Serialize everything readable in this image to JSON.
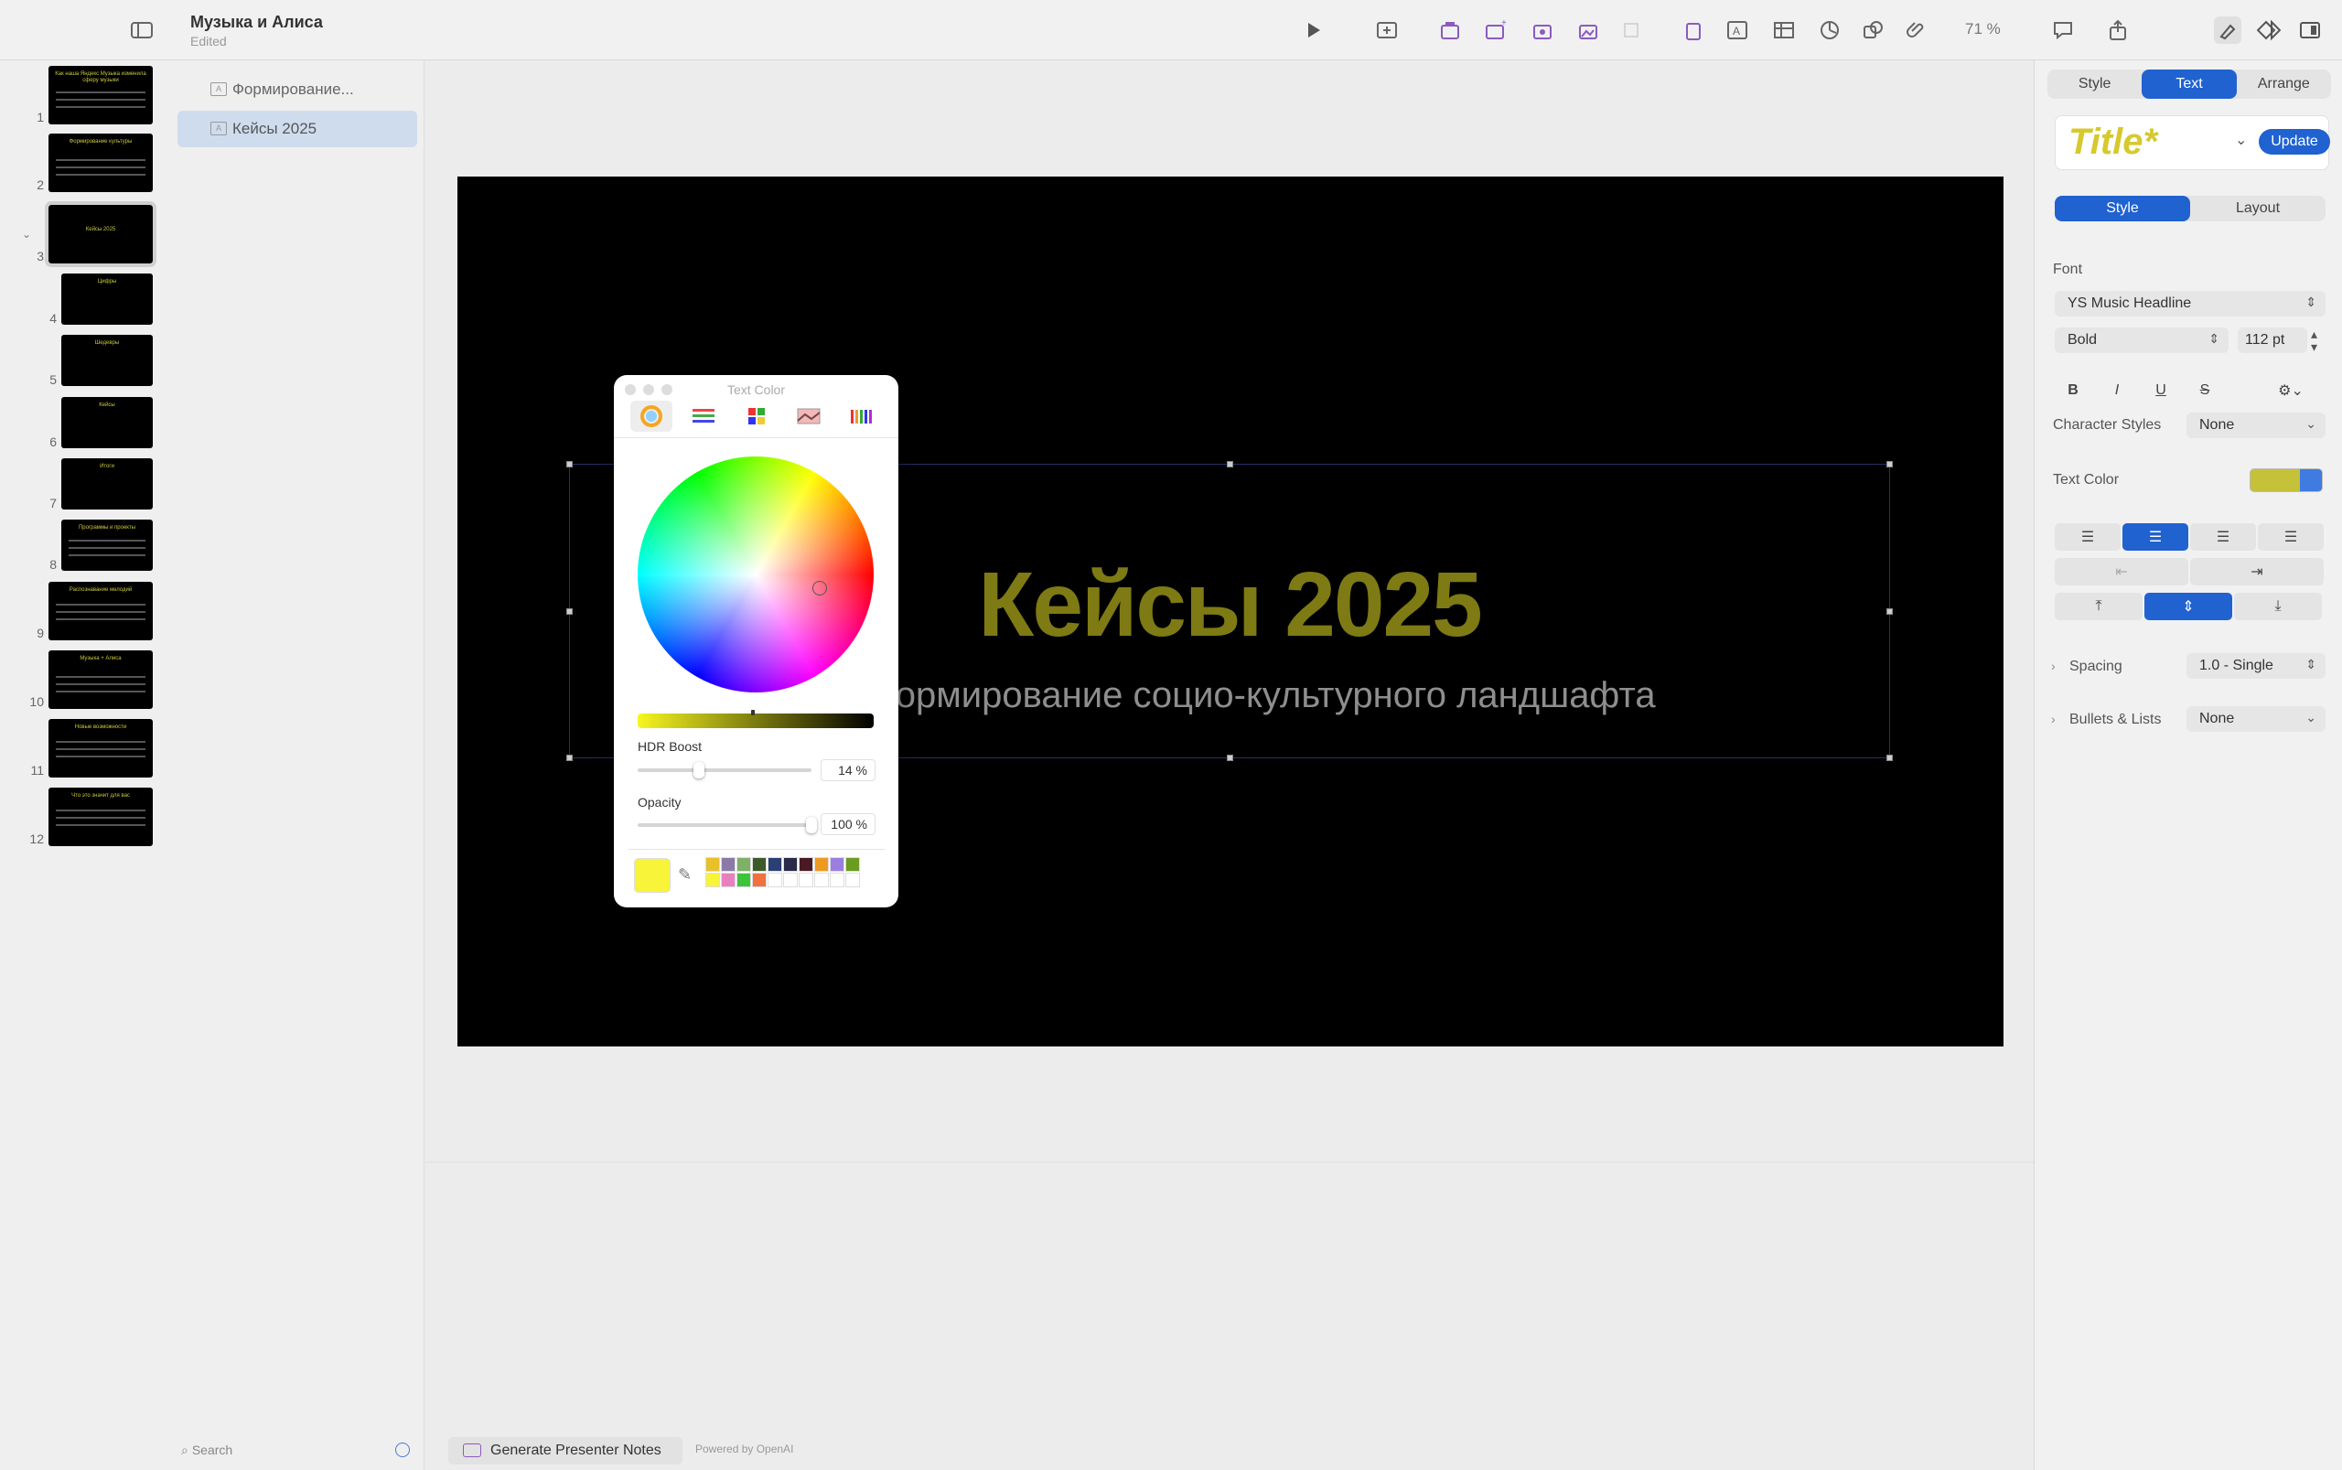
{
  "window": {
    "doc_title": "Музыка и Алиса",
    "doc_status": "Edited",
    "zoom": "71 %"
  },
  "thumbnails": [
    {
      "num": "1",
      "title": "Как наша Яндекс Музыка изменила сферу музыки"
    },
    {
      "num": "2",
      "title": "Формирование культуры"
    },
    {
      "num": "3",
      "title": "Кейсы 2025"
    },
    {
      "num": "4",
      "title": "Цифры"
    },
    {
      "num": "5",
      "title": "Шедевры"
    },
    {
      "num": "6",
      "title": "Кейсы"
    },
    {
      "num": "7",
      "title": "Итоги"
    },
    {
      "num": "8",
      "title": "Программы и проекты"
    },
    {
      "num": "9",
      "title": "Распознавание мелодий"
    },
    {
      "num": "10",
      "title": "Музыка + Алиса"
    },
    {
      "num": "11",
      "title": "Новые возможности"
    },
    {
      "num": "12",
      "title": "Что это значит для вас"
    }
  ],
  "outline": {
    "items": [
      "Формирование...",
      "Кейсы 2025"
    ],
    "search_placeholder": "Search"
  },
  "slide": {
    "title": "Кейсы 2025",
    "subtitle": "Формирование социо-культурного ландшафта"
  },
  "notes": {
    "generate_label": "Generate Presenter Notes",
    "powered_by": "Powered by OpenAI"
  },
  "color_panel": {
    "title": "Text Color",
    "hdr_label": "HDR Boost",
    "hdr_value": "14 %",
    "hdr_fraction": 0.35,
    "opacity_label": "Opacity",
    "opacity_value": "100 %",
    "opacity_fraction": 1.0,
    "current_color": "#f8f43a",
    "swatches": [
      "#e8c02a",
      "#8b7aa8",
      "#7fb06a",
      "#3d5a2a",
      "#2a3f74",
      "#2b2a4a",
      "#4a1a24",
      "#ee9a20",
      "#9b7fe0",
      "#6a9c20",
      "#f8f43a",
      "#e880c0",
      "#3ec43a",
      "#f07040",
      "#ffffff",
      "#ffffff",
      "#ffffff",
      "#ffffff",
      "#ffffff",
      "#ffffff"
    ]
  },
  "inspector": {
    "tabs": [
      "Style",
      "Text",
      "Arrange"
    ],
    "active_tab": "Text",
    "paragraph_style": "Title*",
    "update_label": "Update",
    "subtabs": [
      "Style",
      "Layout"
    ],
    "font_label": "Font",
    "font_family": "YS Music Headline",
    "font_weight": "Bold",
    "font_size": "112 pt",
    "bold_label": "B",
    "italic_label": "I",
    "underline_label": "U",
    "strike_label": "S",
    "char_styles_label": "Character Styles",
    "char_styles_value": "None",
    "text_color_label": "Text Color",
    "text_color": "#c5c23a",
    "spacing_label": "Spacing",
    "spacing_value": "1.0 - Single",
    "bullets_label": "Bullets & Lists",
    "bullets_value": "None"
  }
}
